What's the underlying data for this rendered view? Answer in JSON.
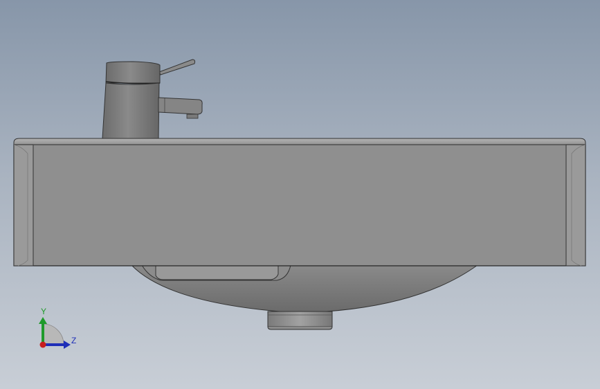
{
  "viewport": {
    "background_top": "#8796a9",
    "background_bottom": "#c8ced6"
  },
  "model": {
    "name": "washbasin-with-faucet",
    "body_color": "#8f8f8f",
    "faucet_color": "#777777"
  },
  "triad": {
    "y_label": "Y",
    "z_label": "Z",
    "y_color": "#1f9a2a",
    "z_color": "#1f2fb8",
    "x_color": "#c81e1e"
  }
}
